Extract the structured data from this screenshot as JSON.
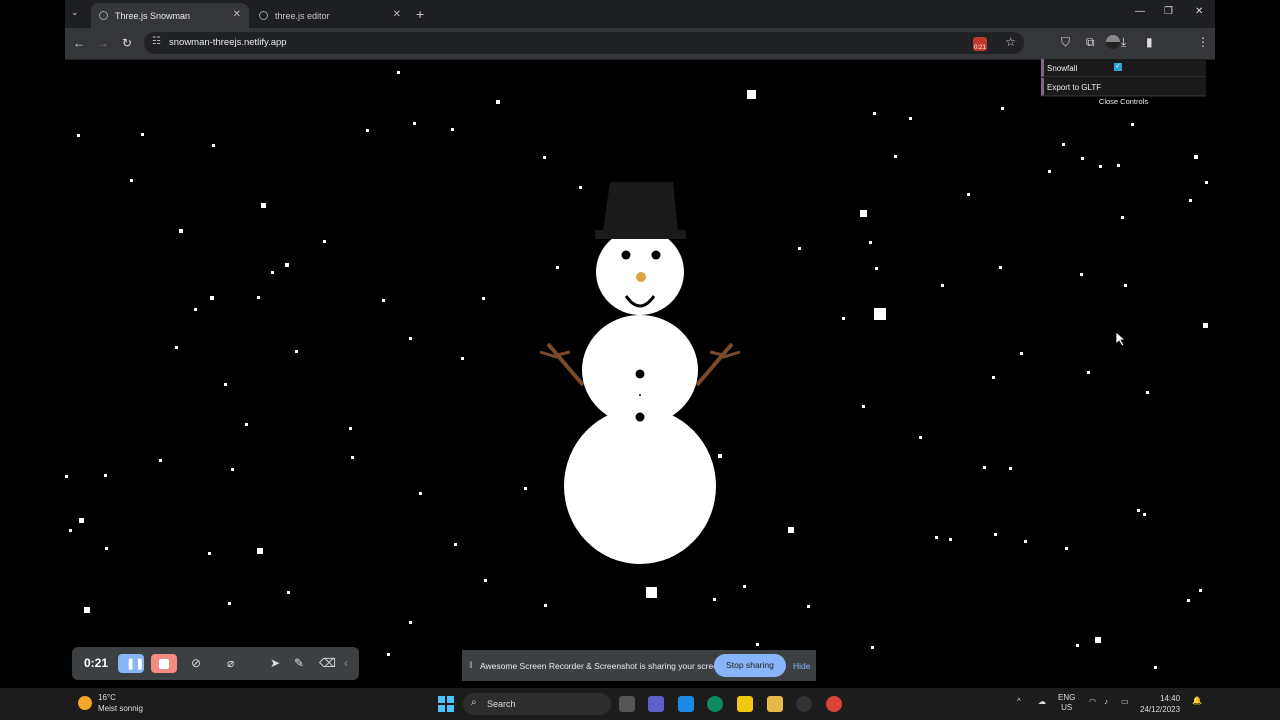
{
  "browser": {
    "tabs": [
      {
        "title": "Three.js Snowman",
        "active": true
      },
      {
        "title": "three.js editor",
        "active": false
      }
    ],
    "url": "snowman-threejs.netlify.app",
    "extension_badge": "0:21"
  },
  "gui": {
    "snowfall_label": "Snowfall",
    "snowfall_checked": true,
    "snowfall_check_glyph": "✓",
    "export_label": "Export to GLTF",
    "close_controls_label": "Close Controls"
  },
  "recorder": {
    "timer": "0:21"
  },
  "share_bar": {
    "message": "Awesome Screen Recorder & Screenshot is sharing your screen.",
    "stop_label": "Stop sharing",
    "hide_label": "Hide"
  },
  "taskbar": {
    "temperature": "16°C",
    "weather": "Meist sonnig",
    "search_placeholder": "Search",
    "language": "ENG",
    "region": "US",
    "time": "14:40",
    "date": "24/12/2023"
  },
  "colors": {
    "background": "#000000",
    "snow": "#ffffff",
    "hat": "#1a1a1a",
    "nose": "#d9a441",
    "arms": "#7a4a2a",
    "accent": "#8ab4f8"
  }
}
